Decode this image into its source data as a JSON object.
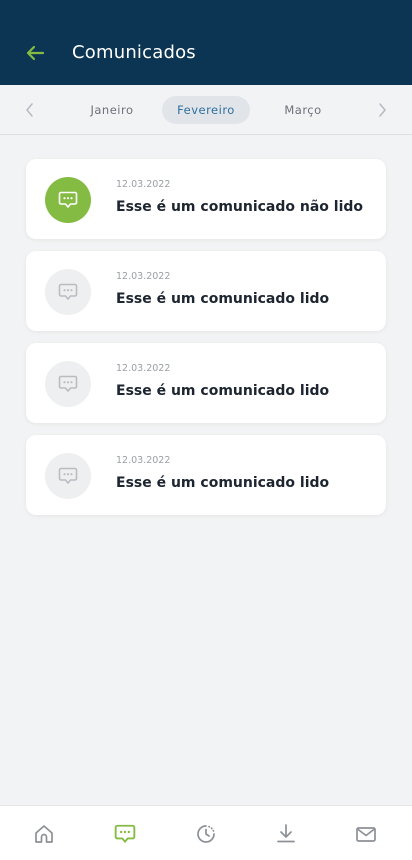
{
  "header": {
    "title": "Comunicados",
    "back_icon": "arrow-left-icon"
  },
  "months": {
    "tabs": [
      {
        "label": "Janeiro",
        "selected": false
      },
      {
        "label": "Fevereiro",
        "selected": true
      },
      {
        "label": "Março",
        "selected": false
      }
    ],
    "prev_icon": "chevron-left-icon",
    "next_icon": "chevron-right-icon"
  },
  "messages": [
    {
      "date": "12.03.2022",
      "text": "Esse é um comunicado não lido",
      "read": false
    },
    {
      "date": "12.03.2022",
      "text": "Esse é um comunicado lido",
      "read": true
    },
    {
      "date": "12.03.2022",
      "text": "Esse é um comunicado lido",
      "read": true
    },
    {
      "date": "12.03.2022",
      "text": "Esse é um comunicado lido",
      "read": true
    }
  ],
  "bottom_nav": {
    "items": [
      {
        "icon": "home-icon",
        "active": false
      },
      {
        "icon": "chat-icon",
        "active": true
      },
      {
        "icon": "clock-history-icon",
        "active": false
      },
      {
        "icon": "download-icon",
        "active": false
      },
      {
        "icon": "mail-icon",
        "active": false
      }
    ]
  },
  "colors": {
    "header_bg": "#0b3552",
    "accent_green": "#84bb42",
    "selected_month_text": "#2f6f9e",
    "background": "#f2f3f4",
    "inactive_icon": "#8c9196"
  }
}
